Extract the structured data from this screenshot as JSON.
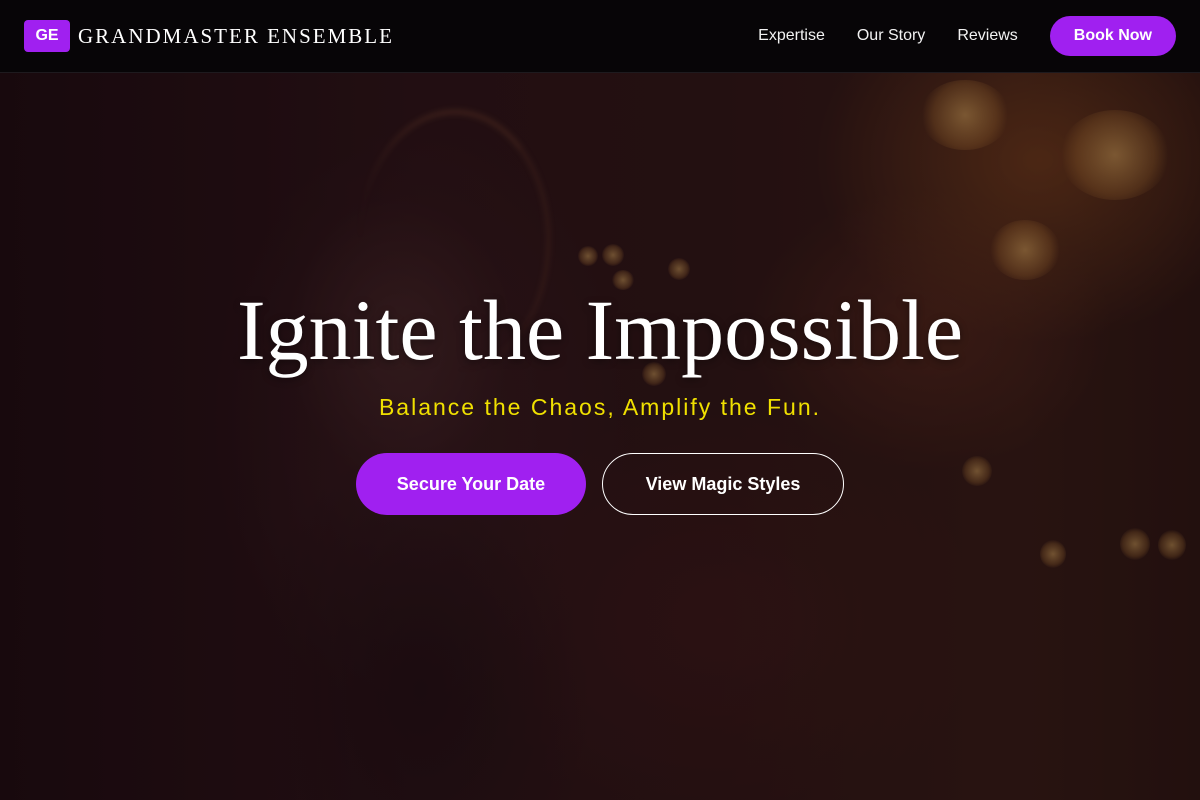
{
  "brand": {
    "badge": "GE",
    "name": "GRANDMASTER ENSEMBLE"
  },
  "nav": {
    "links": [
      "Expertise",
      "Our Story",
      "Reviews"
    ],
    "cta": "Book Now"
  },
  "hero": {
    "title": "Ignite the Impossible",
    "subtitle": "Balance the Chaos, Amplify the Fun.",
    "primary_button": "Secure Your Date",
    "secondary_button": "View Magic Styles"
  },
  "colors": {
    "accent": "#a020f0",
    "subtitle": "#f0e000",
    "navbar": "#070507"
  }
}
